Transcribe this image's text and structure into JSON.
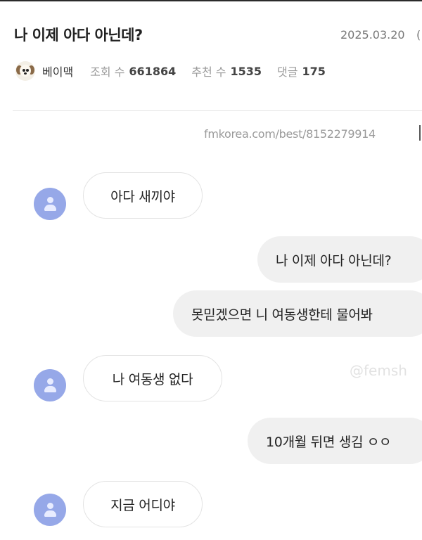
{
  "post": {
    "title": "나 이제 아다 아닌데?",
    "date": "2025.03.20",
    "date_cutoff": "(",
    "author": "베이맥",
    "views_label": "조회 수",
    "views": "661864",
    "recommend_label": "추천 수",
    "recommend": "1535",
    "comments_label": "댓글",
    "comments": "175",
    "source": "fmkorea.com/best/8152279914"
  },
  "messages": [
    {
      "side": "in",
      "text": "아다 새끼야"
    },
    {
      "side": "out",
      "text": "나 이제 아다 아닌데?"
    },
    {
      "side": "out",
      "text": "못믿겠으면 니 여동생한테 물어봐"
    },
    {
      "side": "in",
      "text": "나 여동생 없다"
    },
    {
      "side": "out",
      "text": "10개월 뒤면 생김 ㅇㅇ"
    },
    {
      "side": "in",
      "text": "지금 어디야"
    }
  ],
  "watermark": "@femsh",
  "colors": {
    "incoming_avatar": "#96a8e8",
    "outgoing_bubble": "#f0f0f0",
    "incoming_bubble": "#ffffff"
  },
  "icons": {
    "author_avatar": "dog-avatar-icon",
    "contact_avatar": "person-icon"
  }
}
